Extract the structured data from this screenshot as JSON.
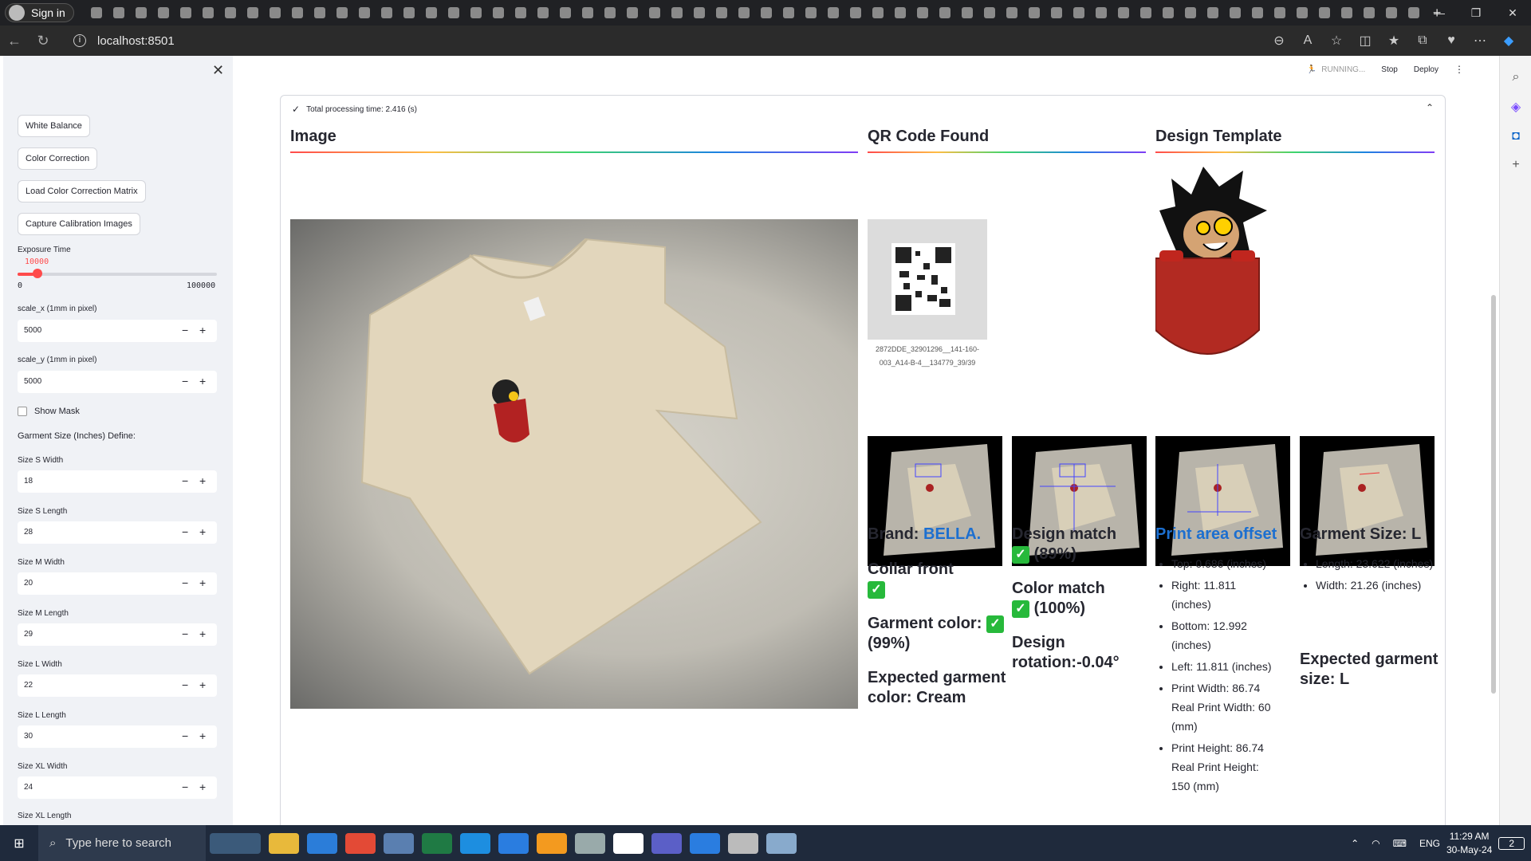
{
  "browser": {
    "signin_label": "Sign in",
    "url": "localhost:8501",
    "window_controls": [
      "—",
      "❐",
      "✕"
    ],
    "nav_icons": [
      "back-icon",
      "refresh-icon"
    ]
  },
  "sidebar": {
    "buttons": [
      "White Balance",
      "Color Correction",
      "Load Color Correction Matrix",
      "Capture Calibration Images"
    ],
    "exposure": {
      "label": "Exposure Time",
      "value": "10000",
      "min": "0",
      "max": "100000",
      "fraction": 0.1
    },
    "scale_x": {
      "label": "scale_x (1mm in pixel)",
      "value": "5000"
    },
    "scale_y": {
      "label": "scale_y (1mm in pixel)",
      "value": "5000"
    },
    "show_mask": "Show Mask",
    "size_heading": "Garment Size (Inches) Define:",
    "sizes": [
      {
        "label": "Size S Width",
        "value": "18"
      },
      {
        "label": "Size S Length",
        "value": "28"
      },
      {
        "label": "Size M Width",
        "value": "20"
      },
      {
        "label": "Size M Length",
        "value": "29"
      },
      {
        "label": "Size L Width",
        "value": "22"
      },
      {
        "label": "Size L Length",
        "value": "30"
      },
      {
        "label": "Size XL Width",
        "value": "24"
      },
      {
        "label": "Size XL Length",
        "value": ""
      }
    ]
  },
  "status": {
    "running": "RUNNING...",
    "stop": "Stop",
    "deploy": "Deploy"
  },
  "expander": {
    "title": "Total processing time: 2.416 (s)"
  },
  "columns": {
    "image": "Image",
    "qr": "QR Code Found",
    "template": "Design Template"
  },
  "qr_caption_1": "2872DDE_32901296__141-160-",
  "qr_caption_2": "003_A14-B-4__134779_39/39",
  "results": {
    "brand_label": "Brand: ",
    "brand_value": "BELLA.",
    "collar": "Collar front",
    "garment_color": "Garment color:",
    "garment_color_pct": "(99%)",
    "expected_color": "Expected garment color: Cream",
    "design_match": "Design match",
    "design_match_pct": "(89%)",
    "color_match": "Color match",
    "color_match_pct": "(100%)",
    "rotation": "Design rotation:-0.04°",
    "print_offset": "Print area offset",
    "offsets": [
      "Top: 0.686 (inches)",
      "Right: 11.811 (inches)",
      "Bottom: 12.992 (inches)",
      "Left: 11.811 (inches)",
      "Print Width: 86.74 Real Print Width: 60 (mm)",
      "Print Height: 86.74 Real Print Height: 150 (mm)"
    ],
    "garment_size": "Garment Size: L",
    "dims": [
      "Length: 23.622 (inches)",
      "Width: 21.26 (inches)"
    ],
    "expected_size": "Expected garment size: L"
  },
  "taskbar": {
    "search": "Type here to search",
    "lang": "ENG",
    "time": "11:29 AM",
    "date": "30-May-24",
    "notif": "2"
  },
  "colors": {
    "accent": "#ff4b4b",
    "link": "#1c6fd0",
    "check": "#27b93b"
  }
}
